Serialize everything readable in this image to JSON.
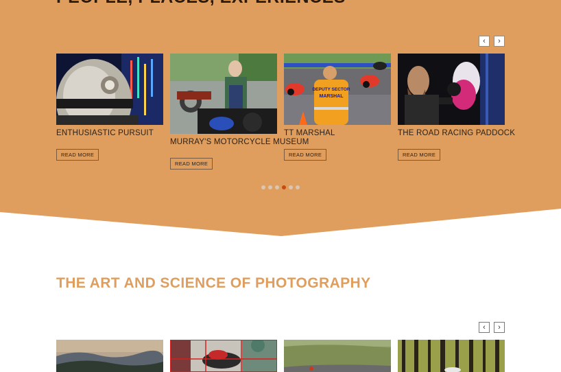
{
  "section1": {
    "title": "PEOPLE, PLACES, EXPERIENCES",
    "prev_label": "‹",
    "next_label": "›",
    "cards": [
      {
        "title": "ENTHUSIASTIC PURSUIT",
        "button": "READ MORE"
      },
      {
        "title": "MURRAY'S MOTORCYCLE MUSEUM",
        "button": "READ MORE"
      },
      {
        "title": "TT MARSHAL",
        "button": "READ MORE",
        "image_text_1": "DEPUTY SECTOR",
        "image_text_2": "MARSHAL"
      },
      {
        "title": "THE ROAD RACING PADDOCK",
        "button": "READ MORE"
      }
    ],
    "pagination": {
      "count": 6,
      "active_index": 3
    }
  },
  "section2": {
    "title": "THE ART AND SCIENCE OF PHOTOGRAPHY",
    "prev_label": "‹",
    "next_label": "›"
  },
  "colors": {
    "band": "#df9e5e",
    "band_light": "#f1cfaa",
    "accent_dot": "#c94a10",
    "heading2": "#df9e5e"
  }
}
